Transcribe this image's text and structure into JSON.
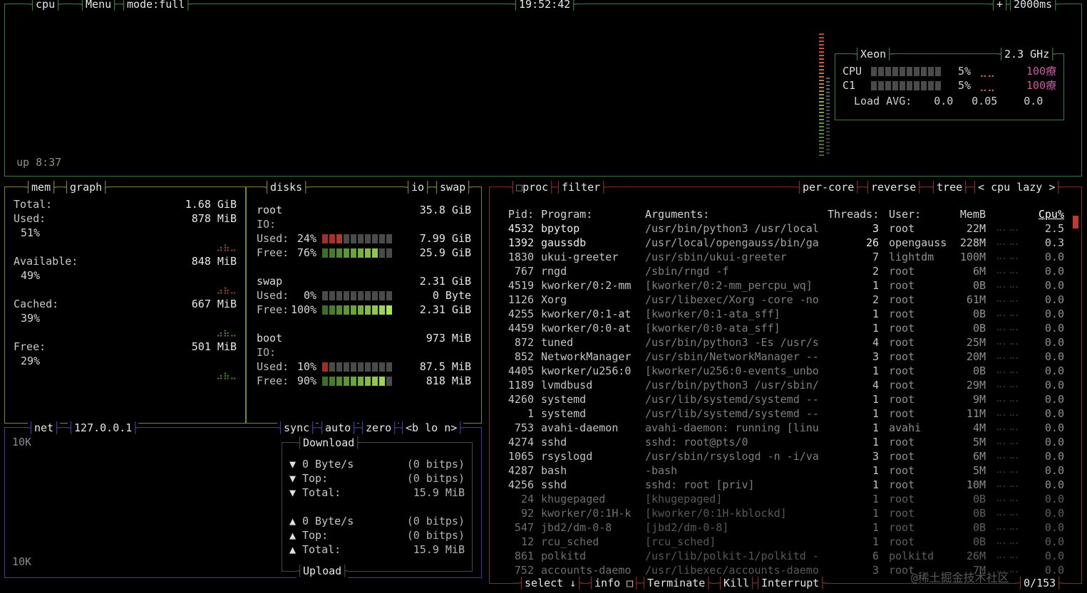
{
  "colors": {
    "cpu_border": "#3d7b46",
    "mem_border": "#84822c",
    "net_border": "#423ba5",
    "proc_border": "#8a2a2a",
    "temp_color": "#c75b9e",
    "meter_off": "#4a4a4a",
    "selected_red": "#c0392b"
  },
  "cpu": {
    "title": "cpu",
    "menu": "Menu",
    "mode": "mode:full",
    "clock": "19:52:42",
    "plus": "+",
    "interval": "2000ms",
    "uptime": "up 8:37",
    "xeon": {
      "name": "Xeon",
      "freq": "2.3 GHz",
      "temp_dots": "⣀⣀",
      "rows": [
        {
          "label": "CPU",
          "pct": "5%",
          "temp": "100療",
          "meter": {
            "total": 10,
            "filled": 0,
            "kind": "green"
          }
        },
        {
          "label": "C1",
          "pct": "5%",
          "temp": "100療",
          "meter": {
            "total": 10,
            "filled": 0,
            "kind": "green"
          }
        }
      ],
      "load_label": "Load AVG:",
      "load_values": [
        "0.0",
        "0.05",
        "0.0"
      ]
    }
  },
  "mem": {
    "title": "mem",
    "tab_graph": "graph",
    "dots_glyph": "⣠⣦⣀",
    "stats": [
      {
        "label": "Total:",
        "value": "1.68 GiB",
        "pct": null
      },
      {
        "label": "Used:",
        "value": "878 MiB",
        "pct": "51%",
        "dots_color": "#c0503a"
      },
      {
        "label": "Available:",
        "value": "848 MiB",
        "pct": "49%",
        "dots_color": "#c0503a"
      },
      {
        "label": "Cached:",
        "value": "667 MiB",
        "pct": "39%",
        "dots_color": "#5a9e3f"
      },
      {
        "label": "Free:",
        "value": "501 MiB",
        "pct": "29%",
        "dots_color": "#5a9e3f"
      }
    ]
  },
  "disks": {
    "title": "disks",
    "tab_io": "io",
    "tab_swap": "swap",
    "list": [
      {
        "name": "root",
        "total": "35.8 GiB",
        "io": "IO:",
        "used_label": "Used:",
        "used_pct": "24%",
        "used_val": "7.99 GiB",
        "used_meter": {
          "total": 10,
          "filled": 3,
          "kind": "red"
        },
        "free_label": "Free:",
        "free_pct": "76%",
        "free_val": "25.9 GiB",
        "free_meter": {
          "total": 10,
          "filled": 8,
          "kind": "green"
        }
      },
      {
        "name": "swap",
        "total": "2.31 GiB",
        "io": null,
        "used_label": "Used:",
        "used_pct": "0%",
        "used_val": "0 Byte",
        "used_meter": {
          "total": 10,
          "filled": 0,
          "kind": "red"
        },
        "free_label": "Free:",
        "free_pct": "100%",
        "free_val": "2.31 GiB",
        "free_meter": {
          "total": 10,
          "filled": 10,
          "kind": "green"
        }
      },
      {
        "name": "boot",
        "total": "973 MiB",
        "io": "IO:",
        "used_label": "Used:",
        "used_pct": "10%",
        "used_val": "87.5 MiB",
        "used_meter": {
          "total": 10,
          "filled": 1,
          "kind": "red"
        },
        "free_label": "Free:",
        "free_pct": "90%",
        "free_val": "818 MiB",
        "free_meter": {
          "total": 10,
          "filled": 9,
          "kind": "green"
        }
      }
    ]
  },
  "net": {
    "title": "net",
    "interface": "127.0.0.1",
    "tab_sync": "sync",
    "tab_auto": "auto",
    "tab_zero": "zero",
    "switcher": "<b lo n>",
    "scale_top": "10K",
    "scale_bottom": "10K",
    "download": {
      "label": "Download",
      "arrow": "▼",
      "rows": [
        {
          "text": "0 Byte/s",
          "value": "(0 bitps)"
        },
        {
          "text": "Top:",
          "value": "(0 bitps)"
        },
        {
          "text": "Total:",
          "value": "15.9 MiB"
        }
      ]
    },
    "upload": {
      "label": "Upload",
      "arrow": "▲",
      "rows": [
        {
          "text": "0 Byte/s",
          "value": "(0 bitps)"
        },
        {
          "text": "Top:",
          "value": "(0 bitps)"
        },
        {
          "text": "Total:",
          "value": "15.9 MiB"
        }
      ]
    }
  },
  "proc": {
    "icon": "□",
    "title": "proc",
    "tab_filter": "filter",
    "tab_percore": "per-core",
    "tab_reverse": "reverse",
    "tab_tree": "tree",
    "sort": "< cpu lazy >",
    "headers": {
      "pid": "Pid:",
      "program": "Program:",
      "args": "Arguments:",
      "threads": "Threads:",
      "user": "User:",
      "mem": "MemB",
      "cpu": "Cpu%"
    },
    "row_dots": "⠤⠄⠤⠄",
    "rows": [
      {
        "pid": "4532",
        "program": "bpytop",
        "args": "/usr/bin/python3 /usr/local",
        "threads": "3",
        "user": "root",
        "mem": "22M",
        "cpu": "2.5"
      },
      {
        "pid": "1392",
        "program": "gaussdb",
        "args": "/usr/local/opengauss/bin/ga",
        "threads": "26",
        "user": "opengauss",
        "mem": "228M",
        "cpu": "0.3"
      },
      {
        "pid": "1830",
        "program": "ukui-greeter",
        "args": "/usr/sbin/ukui-greeter",
        "threads": "7",
        "user": "lightdm",
        "mem": "100M",
        "cpu": "0.0"
      },
      {
        "pid": "767",
        "program": "rngd",
        "args": "/sbin/rngd -f",
        "threads": "2",
        "user": "root",
        "mem": "6M",
        "cpu": "0.0"
      },
      {
        "pid": "4519",
        "program": "kworker/0:2-mm",
        "args": "[kworker/0:2-mm_percpu_wq]",
        "threads": "1",
        "user": "root",
        "mem": "0B",
        "cpu": "0.0"
      },
      {
        "pid": "1126",
        "program": "Xorg",
        "args": "/usr/libexec/Xorg -core -no",
        "threads": "2",
        "user": "root",
        "mem": "61M",
        "cpu": "0.0"
      },
      {
        "pid": "4255",
        "program": "kworker/0:1-at",
        "args": "[kworker/0:1-ata_sff]",
        "threads": "1",
        "user": "root",
        "mem": "0B",
        "cpu": "0.0"
      },
      {
        "pid": "4459",
        "program": "kworker/0:0-at",
        "args": "[kworker/0:0-ata_sff]",
        "threads": "1",
        "user": "root",
        "mem": "0B",
        "cpu": "0.0"
      },
      {
        "pid": "872",
        "program": "tuned",
        "args": "/usr/bin/python3 -Es /usr/s",
        "threads": "4",
        "user": "root",
        "mem": "25M",
        "cpu": "0.0"
      },
      {
        "pid": "852",
        "program": "NetworkManager",
        "args": "/usr/sbin/NetworkManager --",
        "threads": "3",
        "user": "root",
        "mem": "20M",
        "cpu": "0.0"
      },
      {
        "pid": "4405",
        "program": "kworker/u256:0",
        "args": "[kworker/u256:0-events_unbo",
        "threads": "1",
        "user": "root",
        "mem": "0B",
        "cpu": "0.0"
      },
      {
        "pid": "1189",
        "program": "lvmdbusd",
        "args": "/usr/bin/python3 /usr/sbin/",
        "threads": "4",
        "user": "root",
        "mem": "29M",
        "cpu": "0.0"
      },
      {
        "pid": "4260",
        "program": "systemd",
        "args": "/usr/lib/systemd/systemd --",
        "threads": "1",
        "user": "root",
        "mem": "9M",
        "cpu": "0.0"
      },
      {
        "pid": "1",
        "program": "systemd",
        "args": "/usr/lib/systemd/systemd --",
        "threads": "1",
        "user": "root",
        "mem": "11M",
        "cpu": "0.0"
      },
      {
        "pid": "753",
        "program": "avahi-daemon",
        "args": "avahi-daemon: running [linu",
        "threads": "1",
        "user": "avahi",
        "mem": "4M",
        "cpu": "0.0"
      },
      {
        "pid": "4274",
        "program": "sshd",
        "args": "sshd: root@pts/0",
        "threads": "1",
        "user": "root",
        "mem": "5M",
        "cpu": "0.0"
      },
      {
        "pid": "1065",
        "program": "rsyslogd",
        "args": "/usr/sbin/rsyslogd -n -i/va",
        "threads": "3",
        "user": "root",
        "mem": "6M",
        "cpu": "0.0"
      },
      {
        "pid": "4287",
        "program": "bash",
        "args": "-bash",
        "threads": "1",
        "user": "root",
        "mem": "5M",
        "cpu": "0.0"
      },
      {
        "pid": "4256",
        "program": "sshd",
        "args": "sshd: root [priv]",
        "threads": "1",
        "user": "root",
        "mem": "10M",
        "cpu": "0.0"
      },
      {
        "pid": "24",
        "program": "khugepaged",
        "args": "[khugepaged]",
        "threads": "1",
        "user": "root",
        "mem": "0B",
        "cpu": "0.0",
        "dim": true
      },
      {
        "pid": "92",
        "program": "kworker/0:1H-k",
        "args": "[kworker/0:1H-kblockd]",
        "threads": "1",
        "user": "root",
        "mem": "0B",
        "cpu": "0.0",
        "dim": true
      },
      {
        "pid": "547",
        "program": "jbd2/dm-0-8",
        "args": "[jbd2/dm-0-8]",
        "threads": "1",
        "user": "root",
        "mem": "0B",
        "cpu": "0.0",
        "dim": true
      },
      {
        "pid": "12",
        "program": "rcu_sched",
        "args": "[rcu_sched]",
        "threads": "1",
        "user": "root",
        "mem": "0B",
        "cpu": "0.0",
        "dim": true
      },
      {
        "pid": "861",
        "program": "polkitd",
        "args": "/usr/lib/polkit-1/polkitd -",
        "threads": "6",
        "user": "polkitd",
        "mem": "26M",
        "cpu": "0.0",
        "dim": true
      },
      {
        "pid": "752",
        "program": "accounts-daemo",
        "args": "/usr/libexec/accounts-daemo",
        "threads": "3",
        "user": "root",
        "mem": "7M",
        "cpu": "0.0",
        "dim": true
      }
    ],
    "footer": {
      "select": "select ↓",
      "info": "info □",
      "terminate": "Terminate",
      "kill": "Kill",
      "interrupt": "Interrupt",
      "count": "0/153"
    }
  },
  "watermark": "@稀土掘金技术社区"
}
